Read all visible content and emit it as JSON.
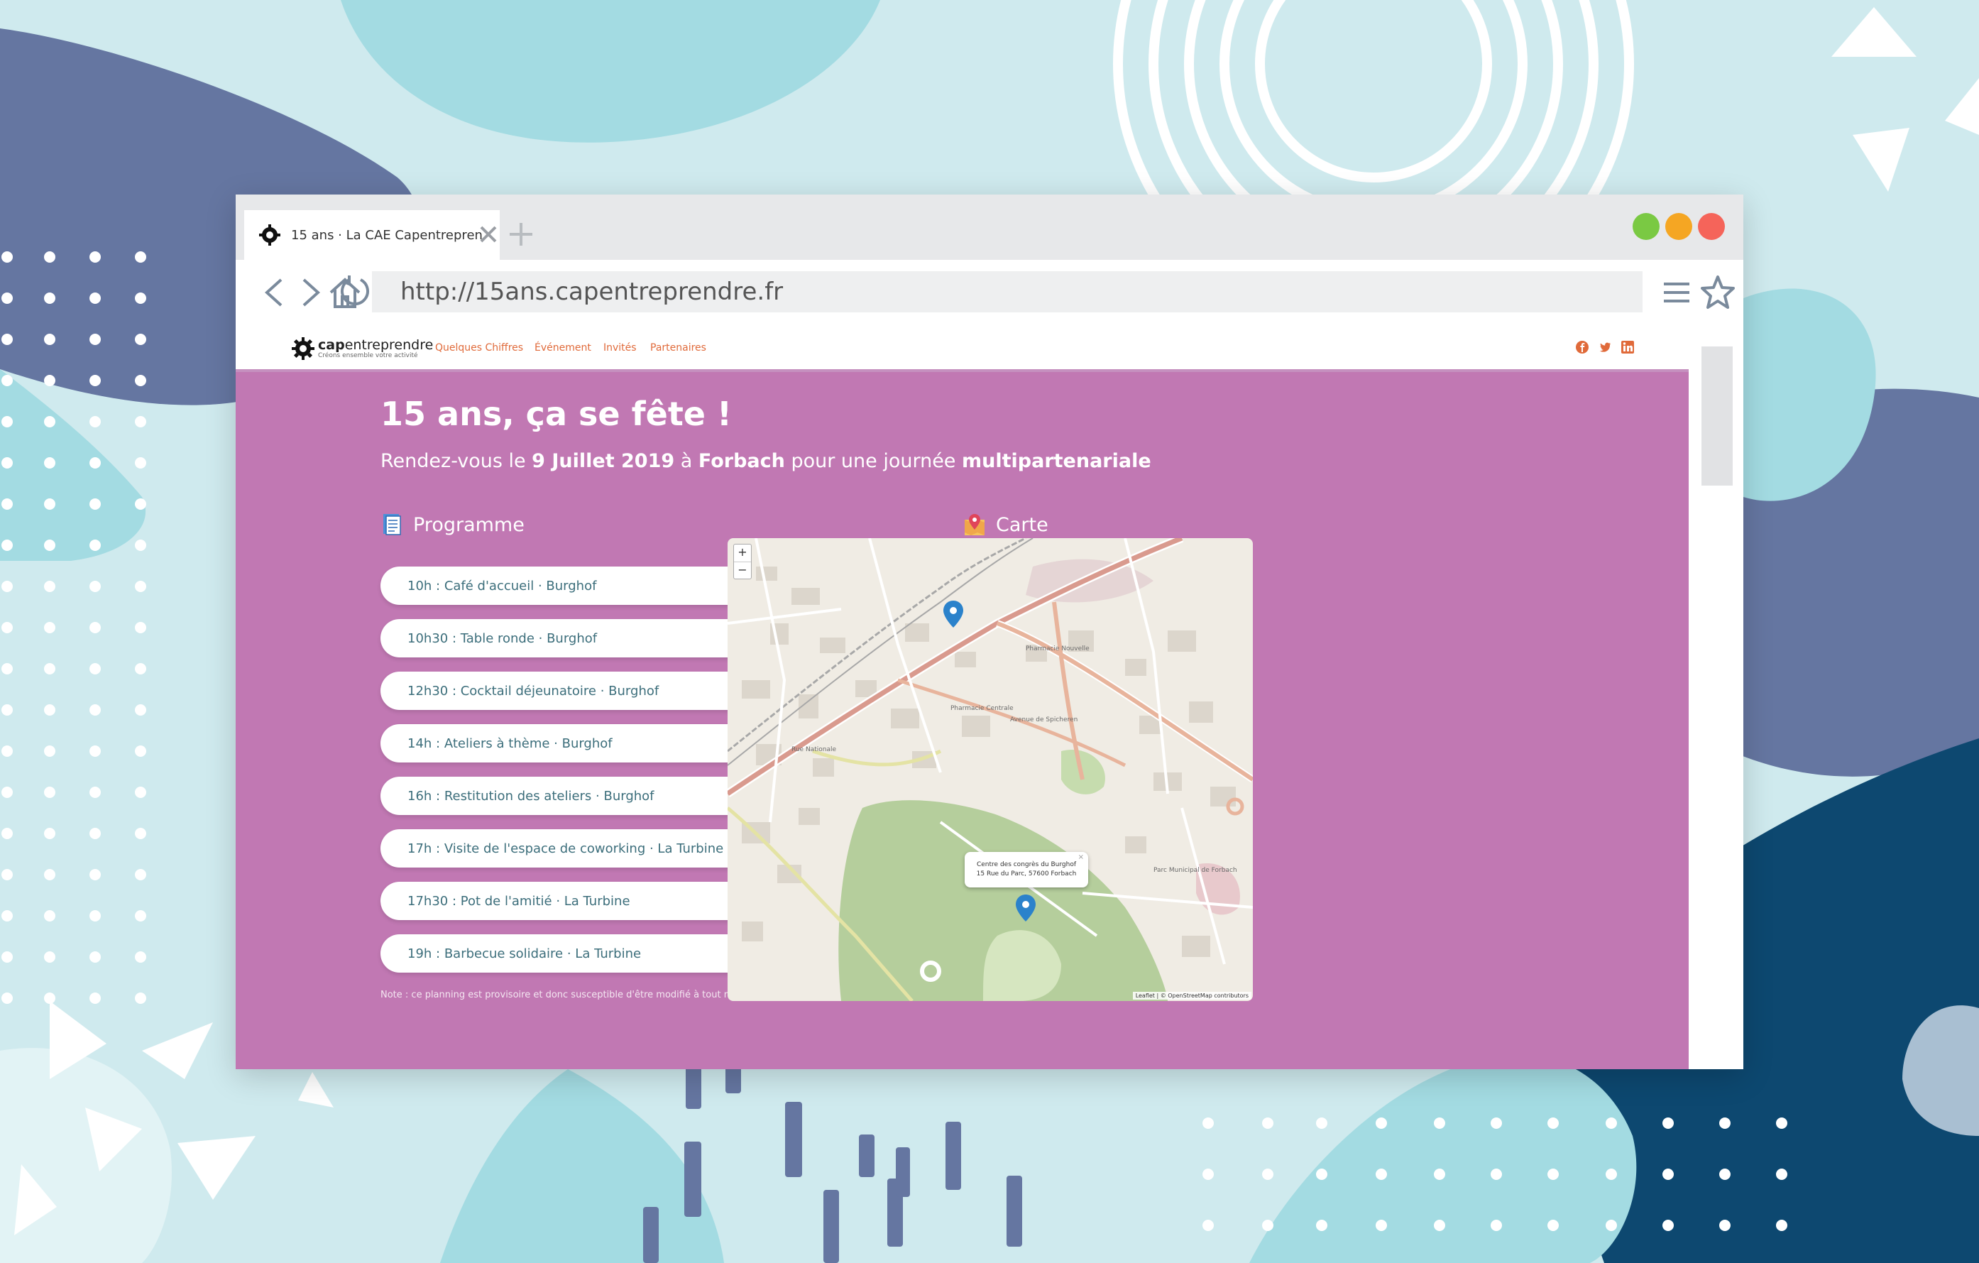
{
  "browser": {
    "tab_title": "15 ans · La CAE Capentrepren",
    "url": "http://15ans.capentreprendre.fr",
    "window_controls": {
      "green": "#7ac943",
      "yellow": "#f5a623",
      "red": "#f5645a"
    }
  },
  "site": {
    "logo": {
      "main_bold": "cap",
      "main_rest": "entreprendre",
      "sub": "Créons ensemble votre activité"
    },
    "nav": [
      "Quelques Chiffres",
      "Événement",
      "Invités",
      "Partenaires"
    ],
    "social_icons": [
      "facebook-icon",
      "twitter-icon",
      "linkedin-icon"
    ]
  },
  "hero": {
    "title": "15 ans, ça se fête !",
    "sub_1": "Rendez-vous le ",
    "sub_date": "9 Juillet 2019",
    "sub_2": " à ",
    "sub_place": "Forbach",
    "sub_3": " pour une journée ",
    "sub_type": "multipartenariale",
    "background": "#c178b3"
  },
  "programme": {
    "heading": "Programme",
    "items": [
      "10h : Café d'accueil · Burghof",
      "10h30 : Table ronde · Burghof",
      "12h30 : Cocktail déjeunatoire · Burghof",
      "14h : Ateliers à thème · Burghof",
      "16h : Restitution des ateliers · Burghof",
      "17h : Visite de l'espace de coworking · La Turbine",
      "17h30 : Pot de l'amitié · La Turbine",
      "19h : Barbecue solidaire · La Turbine"
    ],
    "note": "Note : ce planning est provisoire et donc susceptible d'être modifié à tout moment."
  },
  "carte": {
    "heading": "Carte",
    "zoom_in": "+",
    "zoom_out": "−",
    "popup_line1": "Centre des congrès du Burghof",
    "popup_line2": "15 Rue du Parc, 57600 Forbach",
    "attribution": "Leaflet | © OpenStreetMap contributors",
    "labels": {
      "pharmacie_nouvelle": "Pharmacie Nouvelle",
      "pharmacie_centrale": "Pharmacie Centrale",
      "avenue_spicheren": "Avenue de Spicheren",
      "parc_municipal": "Parc Municipal de Forbach",
      "rue_nationale": "Rue Nationale"
    }
  }
}
